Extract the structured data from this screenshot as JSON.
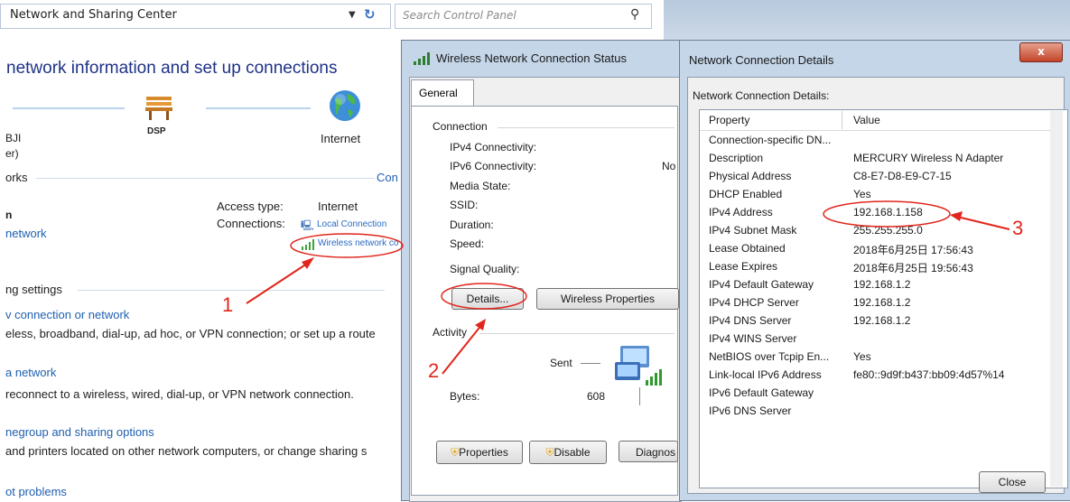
{
  "control_panel": {
    "address": "Network and Sharing Center",
    "search_placeholder": "Search Control Panel",
    "title": "network information and set up connections",
    "map": {
      "left_label_1": "BJI",
      "left_label_2": "er)",
      "mid_label": "DSP",
      "right_label": "Internet"
    },
    "networks_head": "orks",
    "connect_link": "Con",
    "access_type_label": "Access type:",
    "access_type_value": "Internet",
    "connections_label": "Connections:",
    "connection_1": "Local Connection",
    "connection_2": "Wireless network co",
    "left_n": "n",
    "network_link": "network",
    "settings_head": "ng settings",
    "tasks": [
      {
        "link": "v connection or network",
        "desc": "eless, broadband, dial-up, ad hoc, or VPN connection; or set up a route"
      },
      {
        "link": "a network",
        "desc": "reconnect to a wireless, wired, dial-up, or VPN network connection."
      },
      {
        "link": "negroup and sharing options",
        "desc": "and printers located on other network computers, or change sharing s"
      },
      {
        "link": "ot problems",
        "desc": ""
      }
    ]
  },
  "status_window": {
    "title": "Wireless Network Connection Status",
    "tab": "General",
    "connection_group": "Connection",
    "rows": [
      {
        "label": "IPv4 Connectivity:",
        "value": ""
      },
      {
        "label": "IPv6 Connectivity:",
        "value": "No"
      },
      {
        "label": "Media State:",
        "value": ""
      },
      {
        "label": "SSID:",
        "value": ""
      },
      {
        "label": "Duration:",
        "value": ""
      },
      {
        "label": "Speed:",
        "value": ""
      }
    ],
    "signal_quality": "Signal Quality:",
    "details_button": "Details...",
    "wireless_props_button": "Wireless Properties",
    "activity_group": "Activity",
    "sent_label": "Sent",
    "bytes_label": "Bytes:",
    "bytes_sent": "608",
    "properties_button": "Properties",
    "disable_button": "Disable",
    "diagnose_button": "Diagnos"
  },
  "details_window": {
    "title": "Network Connection Details",
    "close_x": "x",
    "caption": "Network Connection Details:",
    "col_property": "Property",
    "col_value": "Value",
    "rows": [
      {
        "p": "Connection-specific DN...",
        "v": ""
      },
      {
        "p": "Description",
        "v": "MERCURY Wireless N Adapter"
      },
      {
        "p": "Physical Address",
        "v": "C8-E7-D8-E9-C7-15"
      },
      {
        "p": "DHCP Enabled",
        "v": "Yes"
      },
      {
        "p": "IPv4 Address",
        "v": "192.168.1.158"
      },
      {
        "p": "IPv4 Subnet Mask",
        "v": "255.255.255.0"
      },
      {
        "p": "Lease Obtained",
        "v": "2018年6月25日 17:56:43"
      },
      {
        "p": "Lease Expires",
        "v": "2018年6月25日 19:56:43"
      },
      {
        "p": "IPv4 Default Gateway",
        "v": "192.168.1.2"
      },
      {
        "p": "IPv4 DHCP Server",
        "v": "192.168.1.2"
      },
      {
        "p": "IPv4 DNS Server",
        "v": "192.168.1.2"
      },
      {
        "p": "IPv4 WINS Server",
        "v": ""
      },
      {
        "p": "NetBIOS over Tcpip En...",
        "v": "Yes"
      },
      {
        "p": "Link-local IPv6 Address",
        "v": "fe80::9d9f:b437:bb09:4d57%14"
      },
      {
        "p": "IPv6 Default Gateway",
        "v": ""
      },
      {
        "p": "IPv6 DNS Server",
        "v": ""
      }
    ],
    "close_button": "Close"
  },
  "annotations": {
    "one": "1",
    "two": "2",
    "three": "3"
  },
  "colors": {
    "annotation_red": "#e0261c",
    "link_blue": "#2060b0",
    "title_blue": "#1e3287"
  }
}
